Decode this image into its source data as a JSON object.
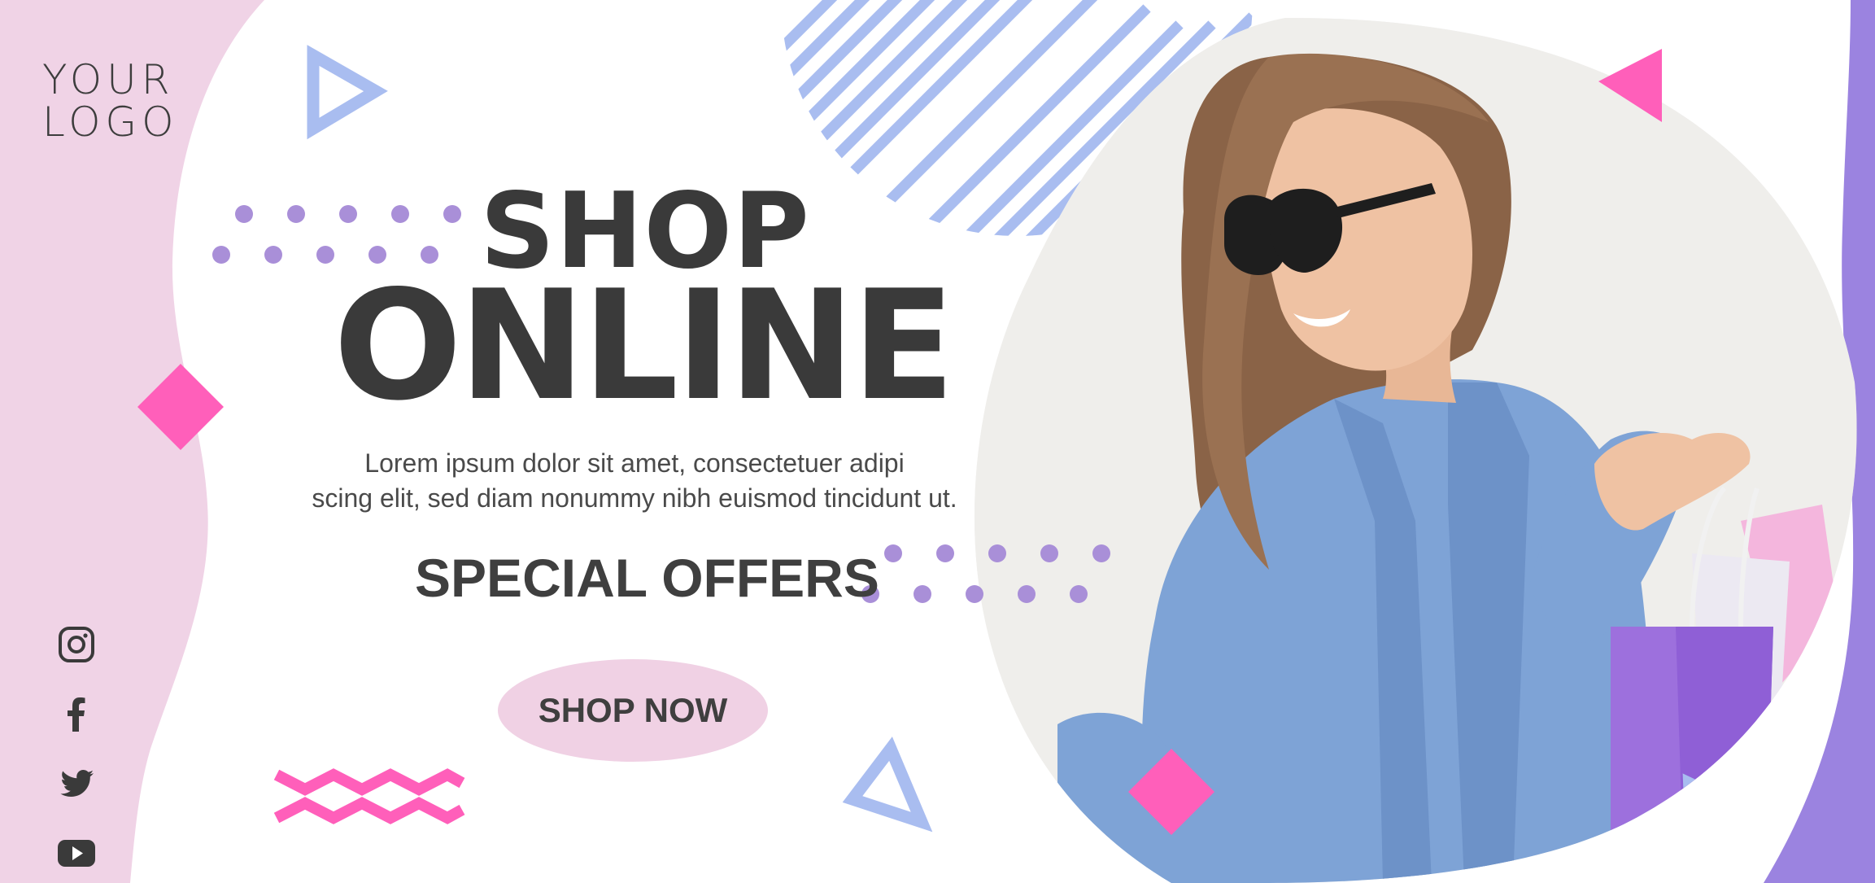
{
  "logo": {
    "line1": "YOUR",
    "line2": "LOGO"
  },
  "headline": {
    "line1": "SHOP",
    "line2": "ONLINE"
  },
  "body": {
    "line1": "Lorem ipsum dolor sit amet, consectetuer adipi",
    "line2": "scing elit, sed diam nonummy nibh euismod tincidunt ut."
  },
  "special_offers": "SPECIAL OFFERS",
  "cta": {
    "label": "SHOP NOW"
  },
  "social": [
    {
      "icon": "instagram-icon"
    },
    {
      "icon": "facebook-icon"
    },
    {
      "icon": "twitter-icon"
    },
    {
      "icon": "youtube-icon"
    }
  ],
  "colors": {
    "pink_panel": "#f0d3e6",
    "magenta": "#ff5fba",
    "dot_purple": "#a98fd8",
    "stripe_blue": "#a9bdf0",
    "triangle_blue": "#a9bdf0",
    "purple_band": "#9b83e0",
    "text_dark": "#3a3a3a"
  }
}
